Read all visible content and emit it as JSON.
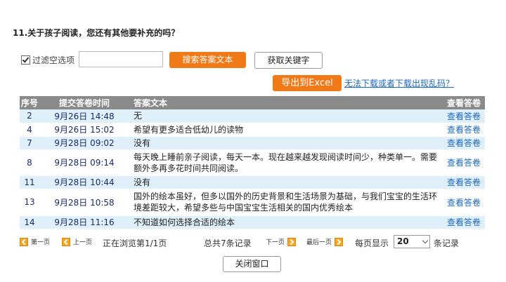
{
  "question_title": "11.关于孩子阅读，您还有其他要补充的吗？",
  "filter": {
    "checkbox_label": "过滤空选项",
    "checked": true,
    "search_value": ""
  },
  "buttons": {
    "search": "搜索答案文本",
    "keywords": "获取关键字",
    "export": "导出到Excel",
    "close": "关闭窗口"
  },
  "help_link": "无法下载或者下载出现乱码？",
  "table": {
    "headers": [
      "序号",
      "提交答卷时间",
      "答案文本",
      "查看答卷"
    ],
    "rows": [
      {
        "id": "2",
        "time": "9月26日 14:48",
        "text": "无",
        "view": "查看答卷"
      },
      {
        "id": "4",
        "time": "9月26日 15:02",
        "text": "希望有更多适合低幼儿的读物",
        "view": "查看答卷"
      },
      {
        "id": "7",
        "time": "9月28日 09:02",
        "text": "没有",
        "view": "查看答卷"
      },
      {
        "id": "8",
        "time": "9月28日 09:14",
        "text": "每天晚上睡前亲子阅读，每天一本。现在越来越发现阅读时间少，种类单一。需要额外多再多花时间共同阅读。",
        "view": "查看答卷"
      },
      {
        "id": "11",
        "time": "9月28日 10:44",
        "text": "没有",
        "view": "查看答卷"
      },
      {
        "id": "13",
        "time": "9月28日 10:58",
        "text": "国外的绘本虽好，但多以国外的历史背景和生活场景为基础，与我们宝宝的生活环境差距较大，希望多些与中国宝宝生活相关的国内优秀绘本",
        "view": "查看答卷"
      },
      {
        "id": "14",
        "time": "9月28日 11:16",
        "text": "不知道如何选择合适的绘本",
        "view": "查看答卷"
      }
    ]
  },
  "pager": {
    "first": "第一页",
    "prev": "上一页",
    "status": "正在浏览第1/1页",
    "total": "总共7条记录",
    "next": "下一页",
    "last": "最后一页",
    "per_page_label": "每页显示",
    "per_page_value": "20",
    "per_page_unit": "条记录"
  },
  "colors": {
    "accent": "#f07a18",
    "header_bg": "#8a8a8a",
    "row_alt": "#e0f0fa",
    "link": "#1a66c2"
  }
}
